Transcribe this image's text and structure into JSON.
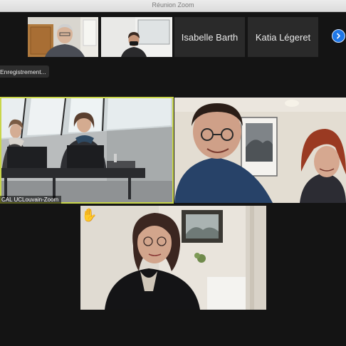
{
  "window": {
    "title": "Réunion Zoom"
  },
  "filmstrip": {
    "participants": [
      {
        "name": "Isabelle Barth"
      },
      {
        "name": "Katia Légeret"
      }
    ],
    "next_icon": "chevron-right-icon"
  },
  "recording": {
    "label": "Enregistrement..."
  },
  "main": {
    "active_speaker_label": "CAL UCLouvain-Zoom",
    "raised_hand_icon": "raised-hand-icon",
    "raised_hand_glyph": "✋",
    "active_border_color": "#c9d64a"
  }
}
